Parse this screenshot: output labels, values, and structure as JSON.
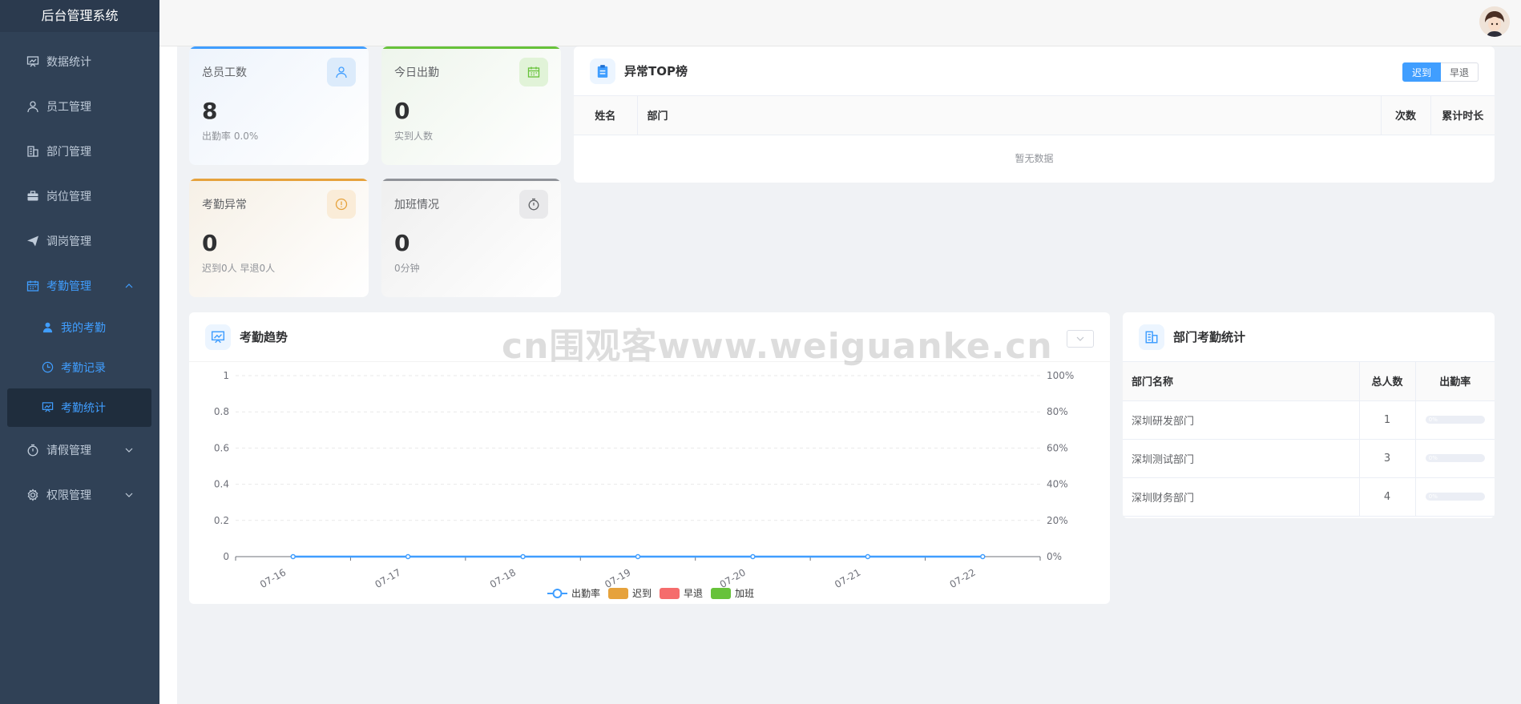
{
  "app": {
    "title": "后台管理系统"
  },
  "sidebar": {
    "items": [
      {
        "label": "数据统计",
        "icon": "chart-icon"
      },
      {
        "label": "员工管理",
        "icon": "user-icon"
      },
      {
        "label": "部门管理",
        "icon": "building-icon"
      },
      {
        "label": "岗位管理",
        "icon": "briefcase-icon"
      },
      {
        "label": "调岗管理",
        "icon": "send-icon"
      },
      {
        "label": "考勤管理",
        "icon": "calendar-icon"
      },
      {
        "label": "请假管理",
        "icon": "stopwatch-icon"
      },
      {
        "label": "权限管理",
        "icon": "gear-icon"
      }
    ],
    "submenu": [
      {
        "label": "我的考勤",
        "icon": "person-icon"
      },
      {
        "label": "考勤记录",
        "icon": "clock-icon"
      },
      {
        "label": "考勤统计",
        "icon": "chart-icon"
      }
    ]
  },
  "stats": [
    {
      "label": "总员工数",
      "value": "8",
      "sub": "出勤率 0.0%",
      "icon": "user-icon",
      "color": "#409eff"
    },
    {
      "label": "今日出勤",
      "value": "0",
      "sub": "实到人数",
      "icon": "calendar-icon",
      "color": "#67c23a"
    },
    {
      "label": "考勤异常",
      "value": "0",
      "sub": "迟到0人 早退0人",
      "icon": "warning-icon",
      "color": "#e6a23c"
    },
    {
      "label": "加班情况",
      "value": "0",
      "sub": "0分钟",
      "icon": "stopwatch-icon",
      "color": "#909399"
    }
  ],
  "top_panel": {
    "title": "异常TOP榜",
    "tabs": [
      "迟到",
      "早退"
    ],
    "columns": [
      "姓名",
      "部门",
      "次数",
      "累计时长"
    ],
    "empty_text": "暂无数据"
  },
  "trend_panel": {
    "title": "考勤趋势"
  },
  "dept_panel": {
    "title": "部门考勤统计",
    "columns": [
      "部门名称",
      "总人数",
      "出勤率"
    ],
    "rows": [
      {
        "name": "深圳研发部门",
        "total": "1",
        "rate": "0%",
        "rate_value": 0
      },
      {
        "name": "深圳测试部门",
        "total": "3",
        "rate": "0%",
        "rate_value": 0
      },
      {
        "name": "深圳财务部门",
        "total": "4",
        "rate": "0%",
        "rate_value": 0
      }
    ]
  },
  "watermark": "cn围观客www.weiguanke.cn",
  "chart_data": {
    "type": "line",
    "x": [
      "07-16",
      "07-17",
      "07-18",
      "07-19",
      "07-20",
      "07-21",
      "07-22"
    ],
    "y_left_ticks": [
      "0",
      "0.2",
      "0.4",
      "0.6",
      "0.8",
      "1"
    ],
    "y_right_ticks": [
      "0%",
      "20%",
      "40%",
      "60%",
      "80%",
      "100%"
    ],
    "ylim": [
      0,
      1
    ],
    "series": [
      {
        "name": "出勤率",
        "values": [
          0,
          0,
          0,
          0,
          0,
          0,
          0
        ],
        "color": "#409eff"
      },
      {
        "name": "迟到",
        "values": [
          0,
          0,
          0,
          0,
          0,
          0,
          0
        ],
        "color": "#e6a23c"
      },
      {
        "name": "早退",
        "values": [
          0,
          0,
          0,
          0,
          0,
          0,
          0
        ],
        "color": "#f56c6c"
      },
      {
        "name": "加班",
        "values": [
          0,
          0,
          0,
          0,
          0,
          0,
          0
        ],
        "color": "#67c23a"
      }
    ],
    "legend": "bottom",
    "grid": true
  }
}
